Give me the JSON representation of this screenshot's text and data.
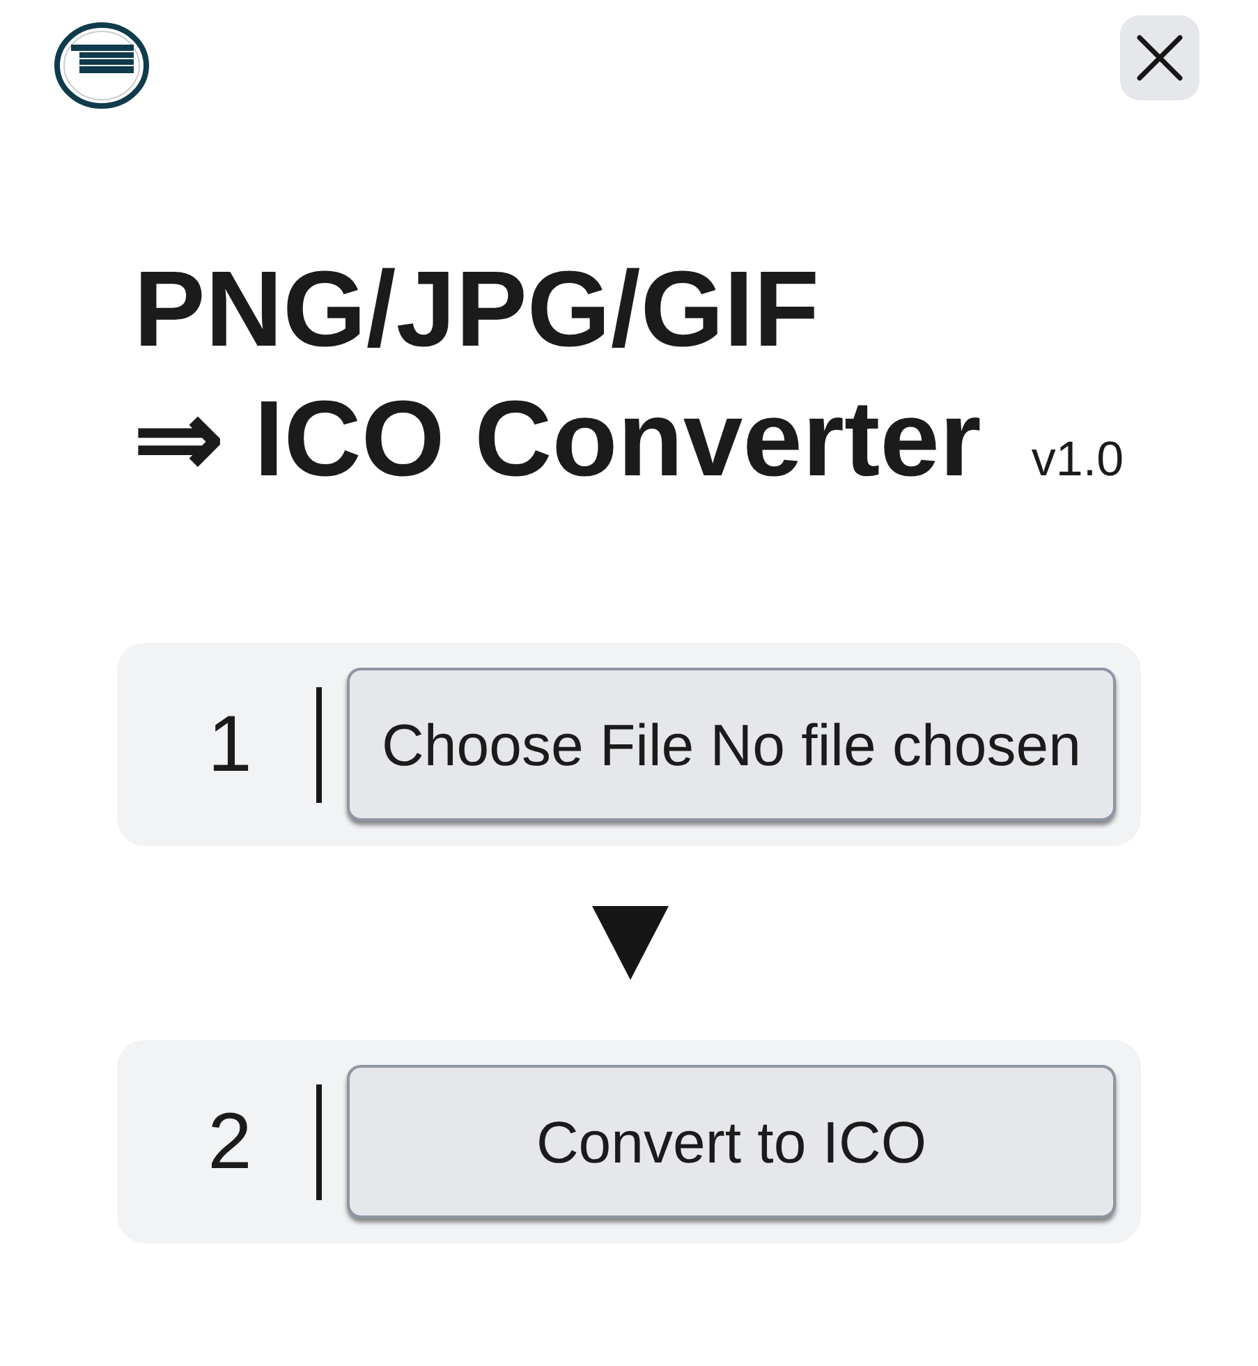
{
  "title": {
    "lines": [
      "PNG/JPG/GIF",
      "⇒ ICO Converter"
    ],
    "version": "v1.0"
  },
  "steps": [
    {
      "number": "1",
      "button_label": "Choose File No file chosen"
    },
    {
      "number": "2",
      "button_label": "Convert to ICO"
    }
  ]
}
